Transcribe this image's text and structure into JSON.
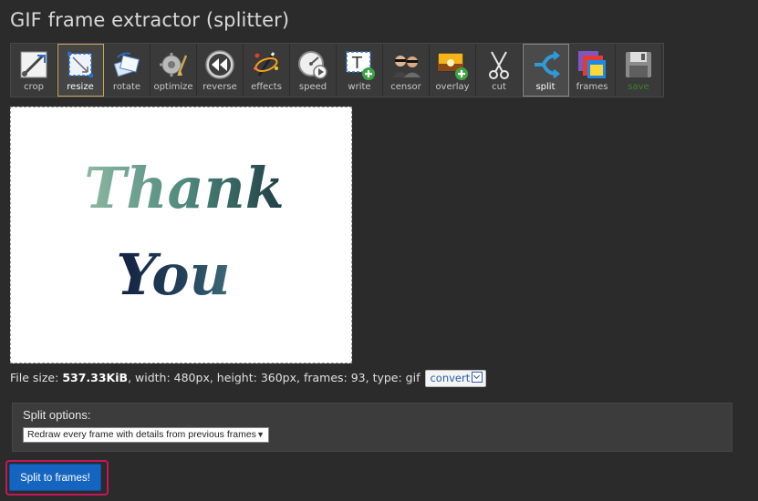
{
  "page": {
    "title": "GIF frame extractor (splitter)"
  },
  "toolbar": {
    "items": [
      {
        "label": "crop",
        "icon": "crop-icon"
      },
      {
        "label": "resize",
        "icon": "resize-icon"
      },
      {
        "label": "rotate",
        "icon": "rotate-icon"
      },
      {
        "label": "optimize",
        "icon": "optimize-icon"
      },
      {
        "label": "reverse",
        "icon": "reverse-icon"
      },
      {
        "label": "effects",
        "icon": "effects-icon"
      },
      {
        "label": "speed",
        "icon": "speed-icon"
      },
      {
        "label": "write",
        "icon": "write-icon"
      },
      {
        "label": "censor",
        "icon": "censor-icon"
      },
      {
        "label": "overlay",
        "icon": "overlay-icon"
      },
      {
        "label": "cut",
        "icon": "scissors-icon"
      },
      {
        "label": "split",
        "icon": "split-icon"
      },
      {
        "label": "frames",
        "icon": "frames-icon"
      },
      {
        "label": "save",
        "icon": "save-icon"
      }
    ],
    "selected": "resize",
    "active": "split"
  },
  "preview": {
    "line1": "Thank",
    "line2": "You"
  },
  "file_info": {
    "size_label": "File size: ",
    "size_value": "537.33KiB",
    "details": ", width: 480px, height: 360px, frames: 93, type: gif",
    "convert_label": "convert"
  },
  "options": {
    "title": "Split options:",
    "select_value": "Redraw every frame with details from previous frames"
  },
  "actions": {
    "split_label": "Split to frames!"
  },
  "colors": {
    "background": "#2b2b2b",
    "primary_button": "#1565c0",
    "highlight_border": "#c2185b"
  }
}
